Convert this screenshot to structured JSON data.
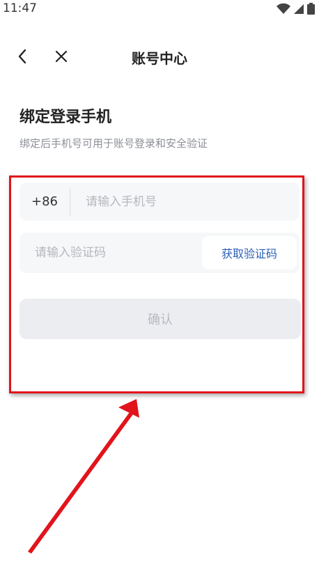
{
  "status_bar": {
    "time": "11:47",
    "icons": [
      "wifi-icon",
      "signal-icon",
      "battery-icon"
    ]
  },
  "nav": {
    "title": "账号中心",
    "back_icon": "chevron-left-icon",
    "close_icon": "close-icon"
  },
  "section": {
    "title": "绑定登录手机",
    "subtitle": "绑定后手机号可用于账号登录和安全验证"
  },
  "form": {
    "country_code": "+86",
    "phone_placeholder": "请输入手机号",
    "code_placeholder": "请输入验证码",
    "get_code_label": "获取验证码",
    "confirm_label": "确认"
  },
  "colors": {
    "accent_link": "#2b5fb8",
    "input_bg": "#f6f7f9",
    "button_disabled_bg": "#ecedf1",
    "annotation_red": "#e2141b"
  }
}
